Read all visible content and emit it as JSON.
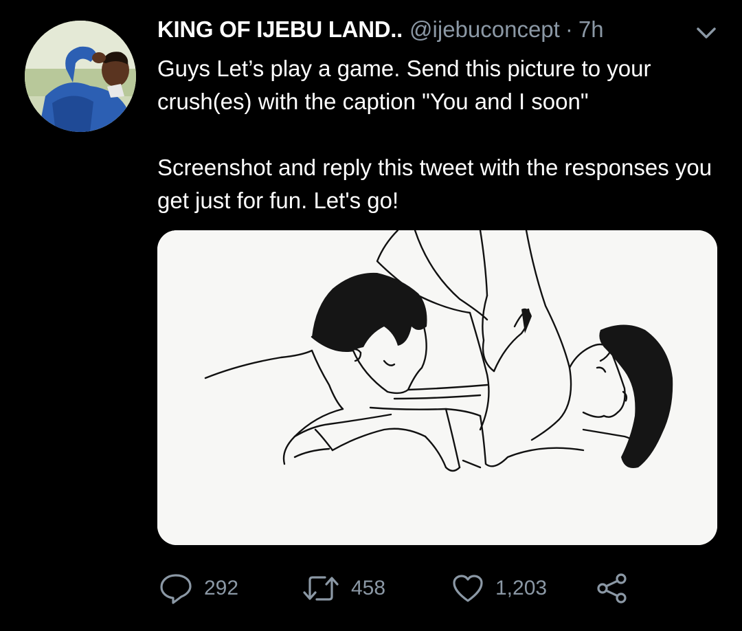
{
  "tweet": {
    "author_name": "KING OF IJEBU LAND..",
    "handle": "@ijebuconcept",
    "separator": "·",
    "time": "7h",
    "text_paragraph_1": "Guys Let’s play a game. Send this picture to your crush(es) with the caption \"You and I soon\"",
    "text_paragraph_2": "Screenshot and reply this tweet with the responses you get just for fun. Let's go!"
  },
  "actions": {
    "replies": "292",
    "retweets": "458",
    "likes": "1,203"
  },
  "icons": {
    "menu": "chevron-down-icon",
    "reply": "comment-bubble-icon",
    "retweet": "retweet-icon",
    "like": "heart-icon",
    "share": "share-icon"
  },
  "colors": {
    "background": "#000000",
    "text": "#ffffff",
    "secondary": "#8b98a5",
    "media_background": "#f7f7f5"
  }
}
